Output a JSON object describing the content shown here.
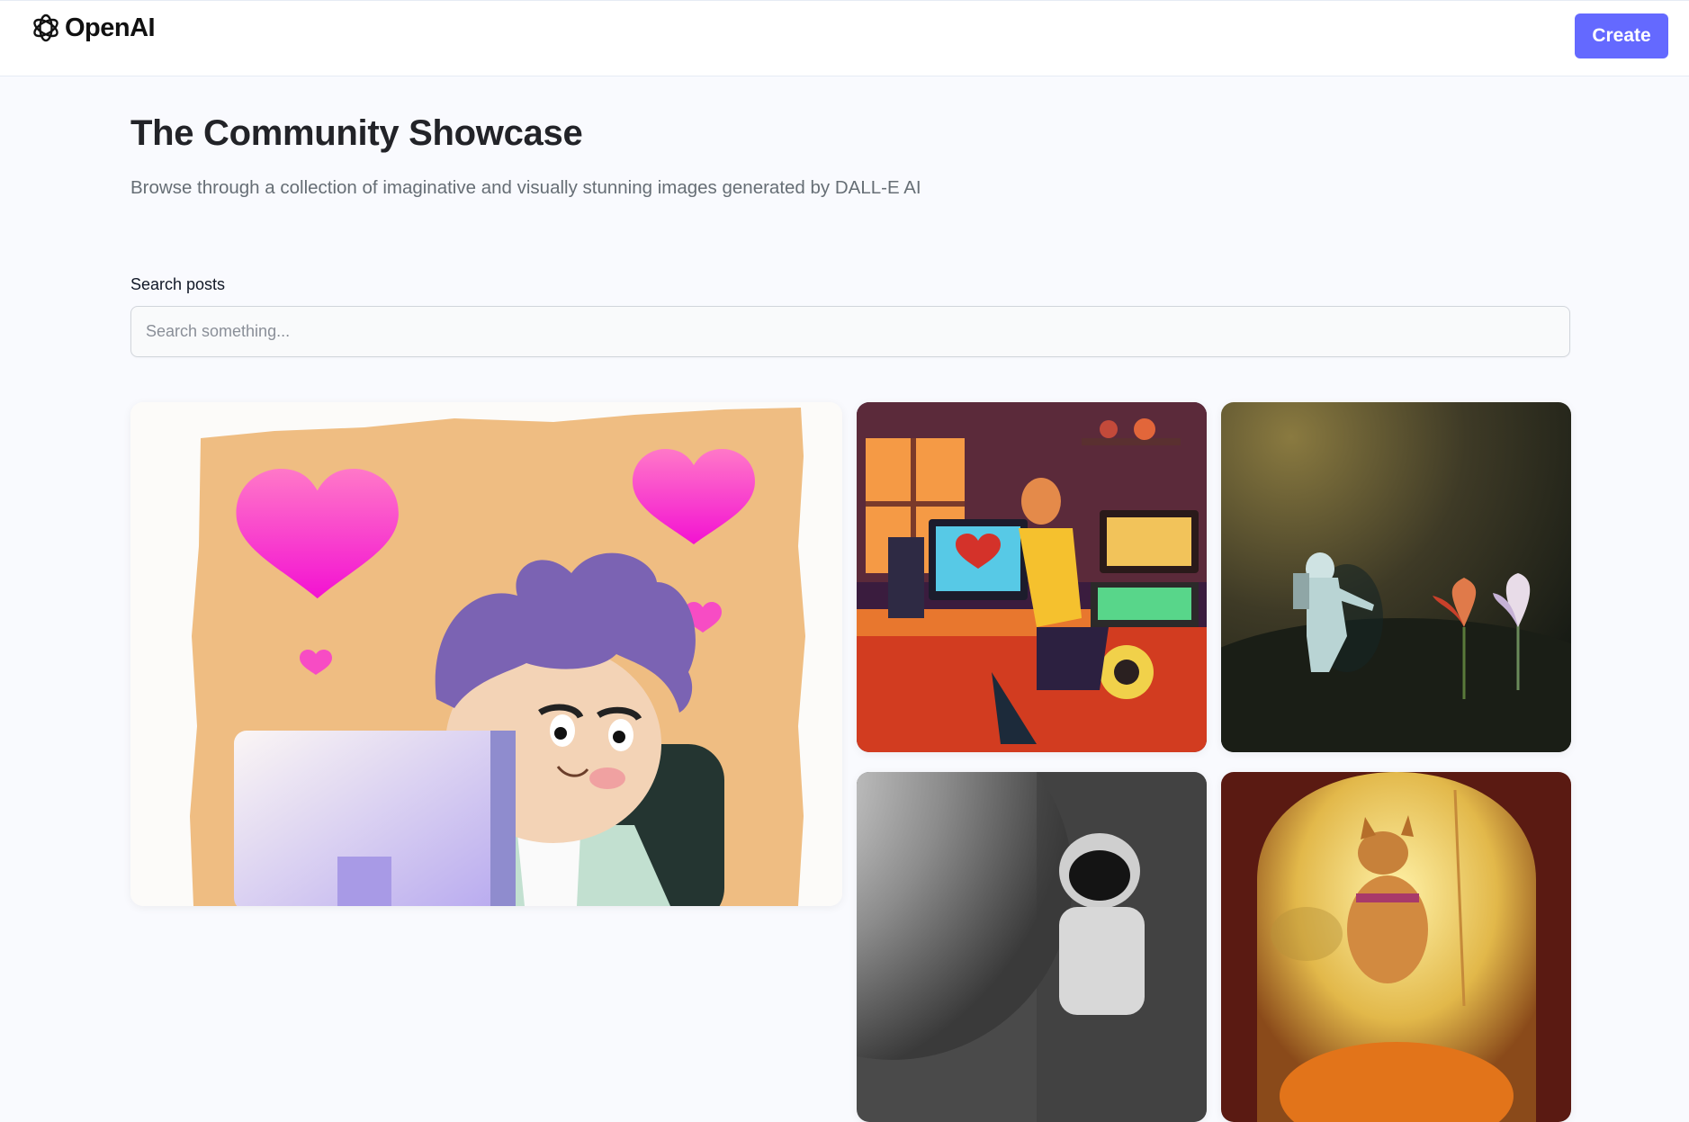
{
  "header": {
    "logo_text": "OpenAI",
    "logo_icon": "openai-logo-icon",
    "create_label": "Create",
    "accent_color": "#6469ff"
  },
  "main": {
    "title": "The Community Showcase",
    "subtitle": "Browse through a collection of imaginative and visually stunning images generated by DALL-E AI",
    "search": {
      "label": "Search posts",
      "placeholder": "Search something...",
      "value": ""
    }
  },
  "gallery": {
    "cards": [
      {
        "image": "illustration-boy-at-computer-with-hearts"
      },
      {
        "image": "illustration-person-at-gaming-desk"
      },
      {
        "image": "photo-astronaut-figure-with-flowers"
      },
      {
        "image": "photo-astronaut-moon-monochrome"
      },
      {
        "image": "illustration-dog-in-golden-archway"
      }
    ]
  }
}
